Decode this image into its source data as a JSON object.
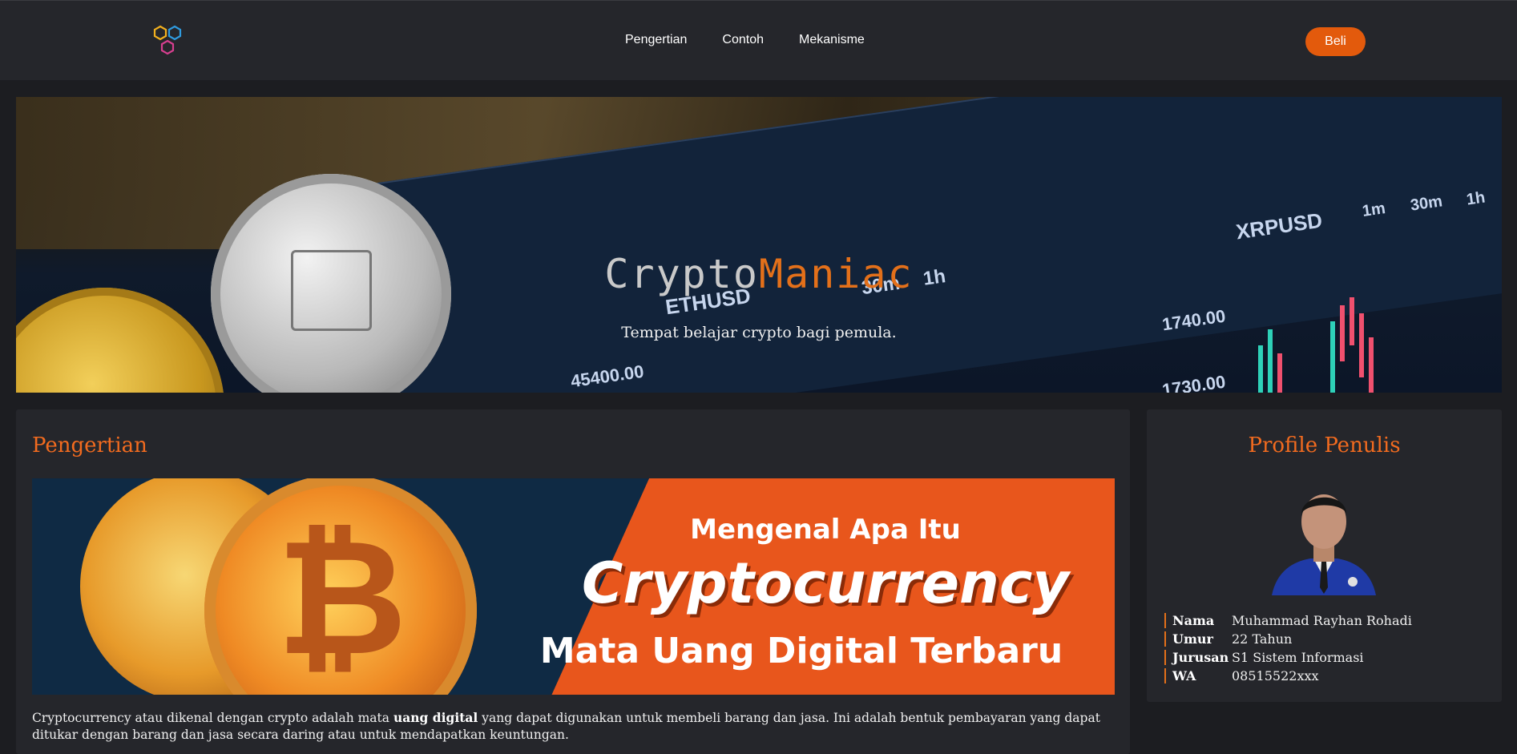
{
  "nav": {
    "logo_icon": "hexagon-cluster-logo",
    "links": [
      "Pengertian",
      "Contoh",
      "Mekanisme"
    ],
    "buy_label": "Beli"
  },
  "hero": {
    "title_part1": "Crypto",
    "title_part2": "Maniac",
    "subtitle": "Tempat belajar crypto bagi pemula.",
    "chart_labels": {
      "ethusd": "ETHUSD",
      "xrpusd": "XRPUSD",
      "price_1": "45400.00",
      "price_2": "1740.00",
      "price_3": "1730.00",
      "tf_30m": "30m",
      "tf_1h": "1h",
      "tf_1m": "1m",
      "tf_30m_b": "30m",
      "tf_1h_b": "1h"
    }
  },
  "main": {
    "section_title": "Pengertian",
    "banner": {
      "line1": "Mengenal Apa Itu",
      "line2": "Cryptocurrency",
      "line3": "Mata Uang Digital Terbaru"
    },
    "paragraph": {
      "before": "Cryptocurrency atau dikenal dengan crypto adalah mata ",
      "bold": "uang digital",
      "after": " yang dapat digunakan untuk membeli barang dan jasa. Ini adalah bentuk pembayaran yang dapat ditukar dengan barang dan jasa secara daring atau untuk mendapatkan keuntungan."
    }
  },
  "profile": {
    "title": "Profile Penulis",
    "rows": [
      {
        "key": "Nama",
        "value": "Muhammad Rayhan Rohadi"
      },
      {
        "key": "Umur",
        "value": "22 Tahun"
      },
      {
        "key": "Jurusan",
        "value": "S1 Sistem Informasi"
      },
      {
        "key": "WA",
        "value": "08515522xxx"
      }
    ]
  },
  "colors": {
    "accent": "#e35a0c",
    "title_orange": "#f26b1f",
    "background": "#1c1d21",
    "card": "#25262b"
  }
}
